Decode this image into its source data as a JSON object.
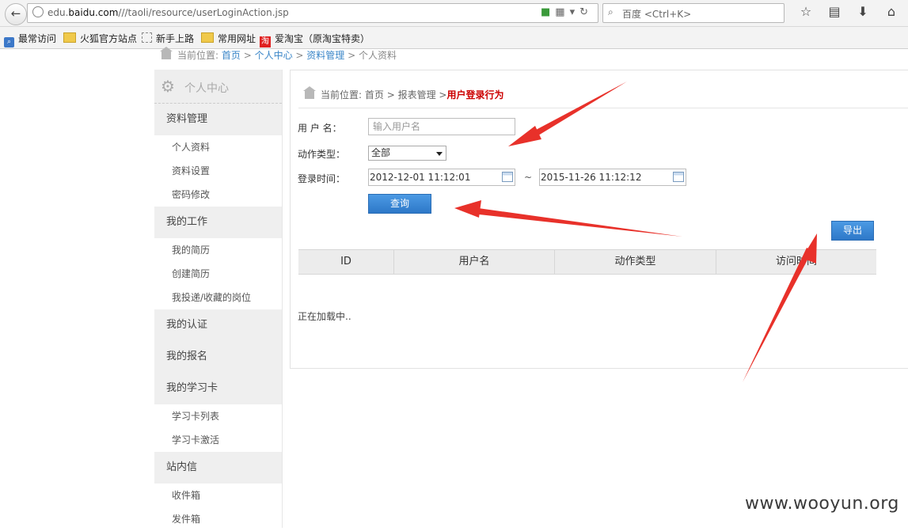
{
  "browser": {
    "url_prefix": "edu.",
    "url_domain": "baidu.com",
    "url_path": "///taoli/resource/userLoginAction.jsp",
    "search_placeholder": "百度 <Ctrl+K>",
    "bookmarks": [
      "最常访问",
      "火狐官方站点",
      "新手上路",
      "常用网址",
      "爱淘宝（原淘宝特卖）"
    ],
    "taobao_glyph": "淘"
  },
  "top_breadcrumb": {
    "prefix": "当前位置:",
    "items": [
      "首页",
      "个人中心",
      "资料管理",
      "个人资料"
    ]
  },
  "sidebar": {
    "title": "个人中心",
    "sections": [
      {
        "label": "资料管理",
        "items": [
          "个人资料",
          "资料设置",
          "密码修改"
        ]
      },
      {
        "label": "我的工作",
        "items": [
          "我的简历",
          "创建简历",
          "我投递/收藏的岗位"
        ]
      },
      {
        "label": "我的认证",
        "items": []
      },
      {
        "label": "我的报名",
        "items": []
      },
      {
        "label": "我的学习卡",
        "items": [
          "学习卡列表",
          "学习卡激活"
        ]
      },
      {
        "label": "站内信",
        "items": [
          "收件箱",
          "发件箱"
        ]
      }
    ]
  },
  "main": {
    "breadcrumb_prefix": "当前位置:",
    "breadcrumb_home": "首页",
    "breadcrumb_mid": "报表管理",
    "breadcrumb_current": "用户登录行为",
    "form": {
      "username_label": "用 户 名：",
      "username_placeholder": "输入用户名",
      "action_label": "动作类型：",
      "action_value": "全部",
      "time_label": "登录时间：",
      "time_start": "2012-12-01 11:12:01",
      "time_sep": "~",
      "time_end": "2015-11-26 11:12:12",
      "query_button": "查询"
    },
    "export_button": "导出",
    "table_headers": [
      "ID",
      "用户名",
      "动作类型",
      "访问时间"
    ],
    "loading_text": "正在加载中.."
  },
  "watermark": "www.wooyun.org",
  "colors": {
    "primary_button": "#2d78c8",
    "annotation_arrow": "#e8312a",
    "current_crumb": "#cc0000",
    "link": "#3a86c8"
  }
}
